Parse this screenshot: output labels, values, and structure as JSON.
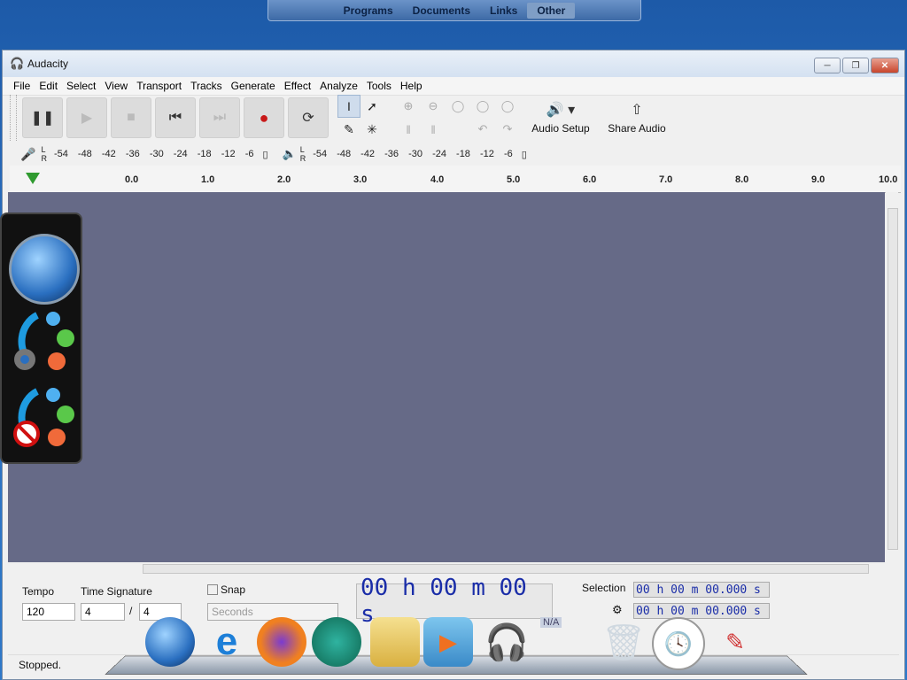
{
  "topbar": {
    "items": [
      "Programs",
      "Documents",
      "Links",
      "Other"
    ]
  },
  "window": {
    "title": "Audacity"
  },
  "menu": [
    "File",
    "Edit",
    "Select",
    "View",
    "Transport",
    "Tracks",
    "Generate",
    "Effect",
    "Analyze",
    "Tools",
    "Help"
  ],
  "toolbar": {
    "audio_setup": "Audio Setup",
    "share_audio": "Share Audio"
  },
  "meters": {
    "rec": {
      "l": "L",
      "r": "R",
      "ticks": [
        "-54",
        "-48",
        "-42",
        "-36",
        "-30",
        "-24",
        "-18",
        "-12",
        "-6"
      ]
    },
    "play": {
      "l": "L",
      "r": "R",
      "ticks": [
        "-54",
        "-48",
        "-42",
        "-36",
        "-30",
        "-24",
        "-18",
        "-12",
        "-6"
      ]
    }
  },
  "ruler": {
    "ticks": [
      "0.0",
      "1.0",
      "2.0",
      "3.0",
      "4.0",
      "5.0",
      "6.0",
      "7.0",
      "8.0",
      "9.0",
      "10.0"
    ]
  },
  "bottom": {
    "tempo_label": "Tempo",
    "tempo_value": "120",
    "time_sig_label": "Time Signature",
    "time_sig_num": "4",
    "time_sig_sep": "/",
    "time_sig_den": "4",
    "snap_label": "Snap",
    "snap_unit": "Seconds",
    "time_display": "00 h 00 m 00 s",
    "selection_label": "Selection",
    "selection_start": "00 h 00 m 00.000 s",
    "selection_end": "00 h 00 m 00.000 s"
  },
  "status": "Stopped.",
  "dock": {
    "na_label": "N/A"
  }
}
